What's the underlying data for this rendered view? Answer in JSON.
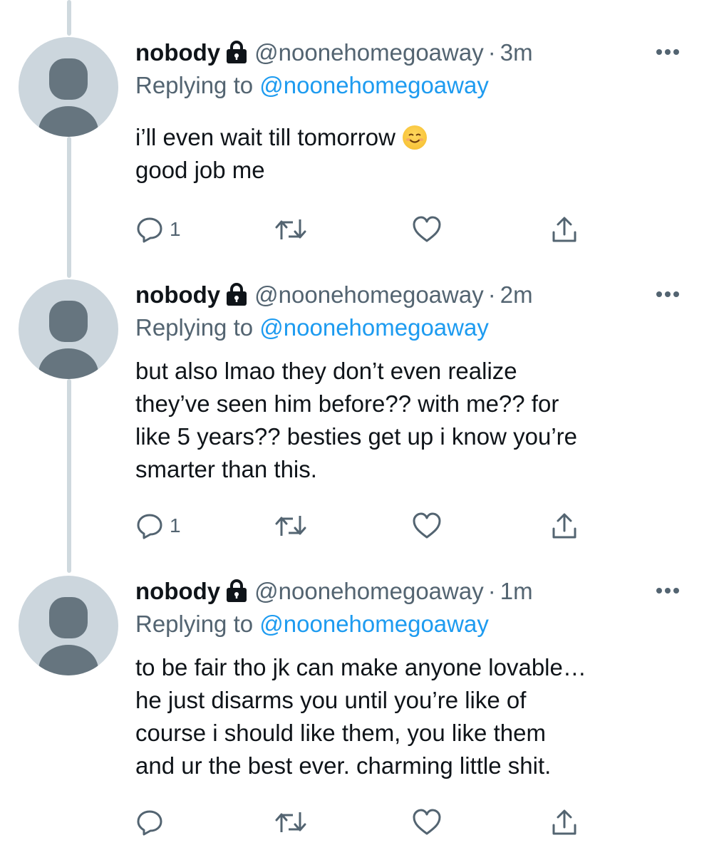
{
  "tweets": [
    {
      "name": "nobody",
      "handle": "@noonehomegoaway",
      "separator": "·",
      "time": "3m",
      "replying_prefix": "Replying to",
      "replying_to": "@noonehomegoaway",
      "lines": [
        "i’ll even wait till tomorrow",
        "good job me"
      ],
      "emoji": "smiling-face-emoji",
      "reply_count": "1"
    },
    {
      "name": "nobody",
      "handle": "@noonehomegoaway",
      "separator": "·",
      "time": "2m",
      "replying_prefix": "Replying to",
      "replying_to": "@noonehomegoaway",
      "lines": [
        "but also lmao they don’t even realize",
        "they’ve seen him before?? with me?? for",
        "like 5 years?? besties get up i know you’re",
        "smarter than this."
      ],
      "reply_count": "1"
    },
    {
      "name": "nobody",
      "handle": "@noonehomegoaway",
      "separator": "·",
      "time": "1m",
      "replying_prefix": "Replying to",
      "replying_to": "@noonehomegoaway",
      "lines": [
        "to be fair tho jk can make anyone lovable…",
        "he just disarms you until you’re like of",
        "course i should like them, you like them",
        "and ur the best ever. charming little shit."
      ],
      "reply_count": ""
    }
  ],
  "icons": [
    "lock-icon",
    "more-icon",
    "reply-icon",
    "retweet-icon",
    "like-icon",
    "share-icon"
  ],
  "colors": {
    "text": "#0f1419",
    "secondary": "#536471",
    "link": "#1d9bf0",
    "thread_line": "#cfd9de",
    "avatar_bg": "#ccd6dd",
    "avatar_fg": "#66757f"
  }
}
